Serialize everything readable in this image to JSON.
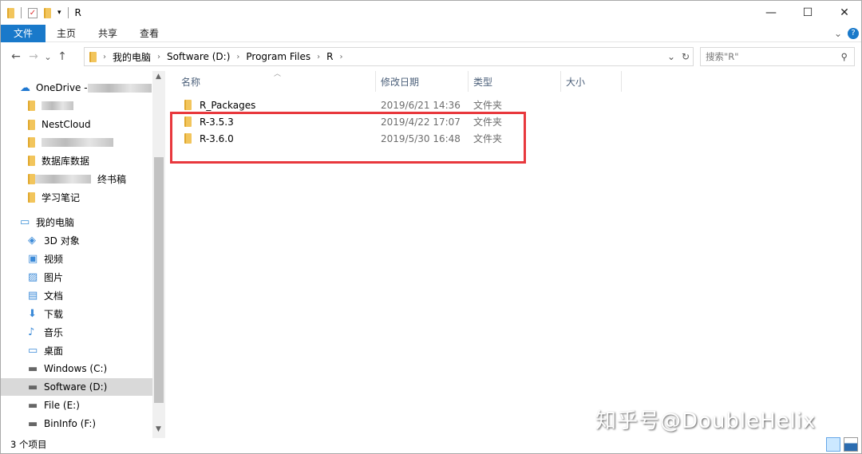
{
  "window": {
    "title": "R",
    "minimize": "—",
    "maximize": "☐",
    "close": "✕"
  },
  "ribbon": {
    "tabs": [
      "文件",
      "主页",
      "共享",
      "查看"
    ]
  },
  "nav": {
    "back": "←",
    "forward": "→",
    "recent": "⌄",
    "up": "↑",
    "refresh": "↻",
    "dropdown": "⌄",
    "breadcrumb": [
      "我的电脑",
      "Software (D:)",
      "Program Files",
      "R"
    ],
    "search_placeholder": "搜索\"R\""
  },
  "sidebar": {
    "items": [
      {
        "label": "OneDrive - ",
        "icon": "cloud-icon"
      },
      {
        "label": "",
        "icon": "folder-icon"
      },
      {
        "label": "NestCloud",
        "icon": "folder-icon"
      },
      {
        "label": "",
        "icon": "folder-icon"
      },
      {
        "label": "数据库数据",
        "icon": "folder-icon"
      },
      {
        "label": "终书稿",
        "icon": "folder-icon"
      },
      {
        "label": "学习笔记",
        "icon": "folder-icon"
      },
      {
        "label": "我的电脑",
        "icon": "computer-icon"
      },
      {
        "label": "3D 对象",
        "icon": "3d-objects-icon"
      },
      {
        "label": "视频",
        "icon": "video-icon"
      },
      {
        "label": "图片",
        "icon": "pictures-icon"
      },
      {
        "label": "文档",
        "icon": "documents-icon"
      },
      {
        "label": "下载",
        "icon": "download-icon"
      },
      {
        "label": "音乐",
        "icon": "music-icon"
      },
      {
        "label": "桌面",
        "icon": "desktop-icon"
      },
      {
        "label": "Windows (C:)",
        "icon": "drive-icon"
      },
      {
        "label": "Software (D:)",
        "icon": "drive-icon"
      },
      {
        "label": "File (E:)",
        "icon": "drive-icon"
      },
      {
        "label": "BinInfo (F:)",
        "icon": "drive-icon"
      }
    ]
  },
  "columns": [
    "名称",
    "修改日期",
    "类型",
    "大小"
  ],
  "files": [
    {
      "name": "R_Packages",
      "date": "2019/6/21 14:36",
      "type": "文件夹"
    },
    {
      "name": "R-3.5.3",
      "date": "2019/4/22 17:07",
      "type": "文件夹"
    },
    {
      "name": "R-3.6.0",
      "date": "2019/5/30 16:48",
      "type": "文件夹"
    }
  ],
  "status": {
    "count": "3 个项目"
  },
  "watermark": "知乎号@DoubleHelix",
  "colors": {
    "accent": "#1979ca",
    "highlight": "#e8383d"
  }
}
